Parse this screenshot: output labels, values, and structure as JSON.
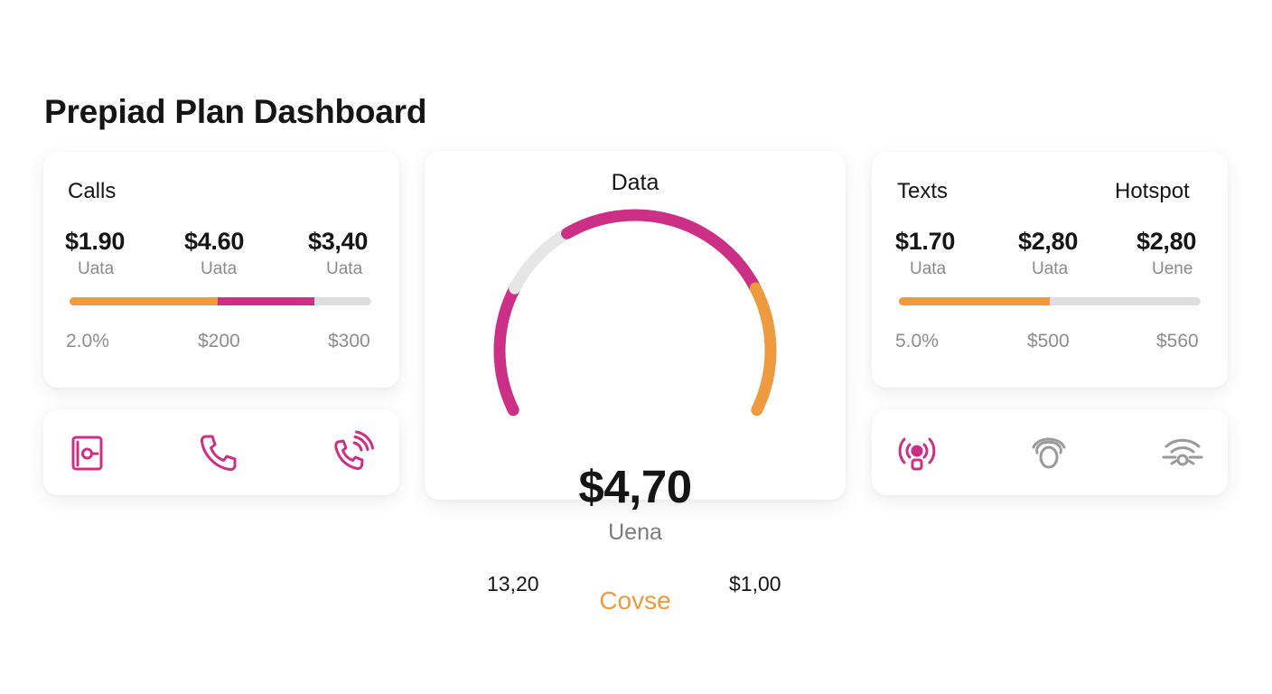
{
  "page": {
    "title": "Prepiad Plan Dashboard"
  },
  "colors": {
    "magenta": "#cc2f86",
    "orange": "#ee9a3f",
    "track": "#e6e6e6",
    "muted_icon": "#9a9a9a"
  },
  "calls": {
    "title": "Calls",
    "stats": [
      {
        "value": "$1.90",
        "label": "Uata"
      },
      {
        "value": "$4.60",
        "label": "Uata"
      },
      {
        "value": "$3,40",
        "label": "Uata"
      }
    ],
    "progress": {
      "orange_fraction": 0.49,
      "magenta_fraction": 0.32
    },
    "scale": [
      "2.0%",
      "$200",
      "$300"
    ]
  },
  "calls_icons": [
    {
      "name": "voicemail-icon",
      "color": "magenta"
    },
    {
      "name": "phone-icon",
      "color": "magenta"
    },
    {
      "name": "phone-ringing-icon",
      "color": "magenta"
    }
  ],
  "data_card": {
    "title": "Data",
    "value": "$4,70",
    "sub": "Uena",
    "min_label": "13,20",
    "max_label": "$1,00",
    "status": "Covse",
    "gauge_segments": [
      {
        "color": "magenta",
        "fraction": 0.23
      },
      {
        "color": "track",
        "fraction": 0.14
      },
      {
        "color": "magenta",
        "fraction": 0.4
      },
      {
        "color": "orange",
        "fraction": 0.23
      }
    ]
  },
  "texts_hotspot": {
    "title_left": "Texts",
    "title_right": "Hotspot",
    "stats": [
      {
        "value": "$1.70",
        "label": "Uata"
      },
      {
        "value": "$2,80",
        "label": "Uata"
      },
      {
        "value": "$2,80",
        "label": "Uene"
      }
    ],
    "progress": {
      "orange_fraction": 0.5
    },
    "scale": [
      "5.0%",
      "$500",
      "$560"
    ]
  },
  "hotspot_icons": [
    {
      "name": "hotspot-broadcast-icon",
      "color": "magenta"
    },
    {
      "name": "hotspot-signal-icon",
      "color": "muted"
    },
    {
      "name": "wifi-hotspot-icon",
      "color": "muted"
    }
  ]
}
